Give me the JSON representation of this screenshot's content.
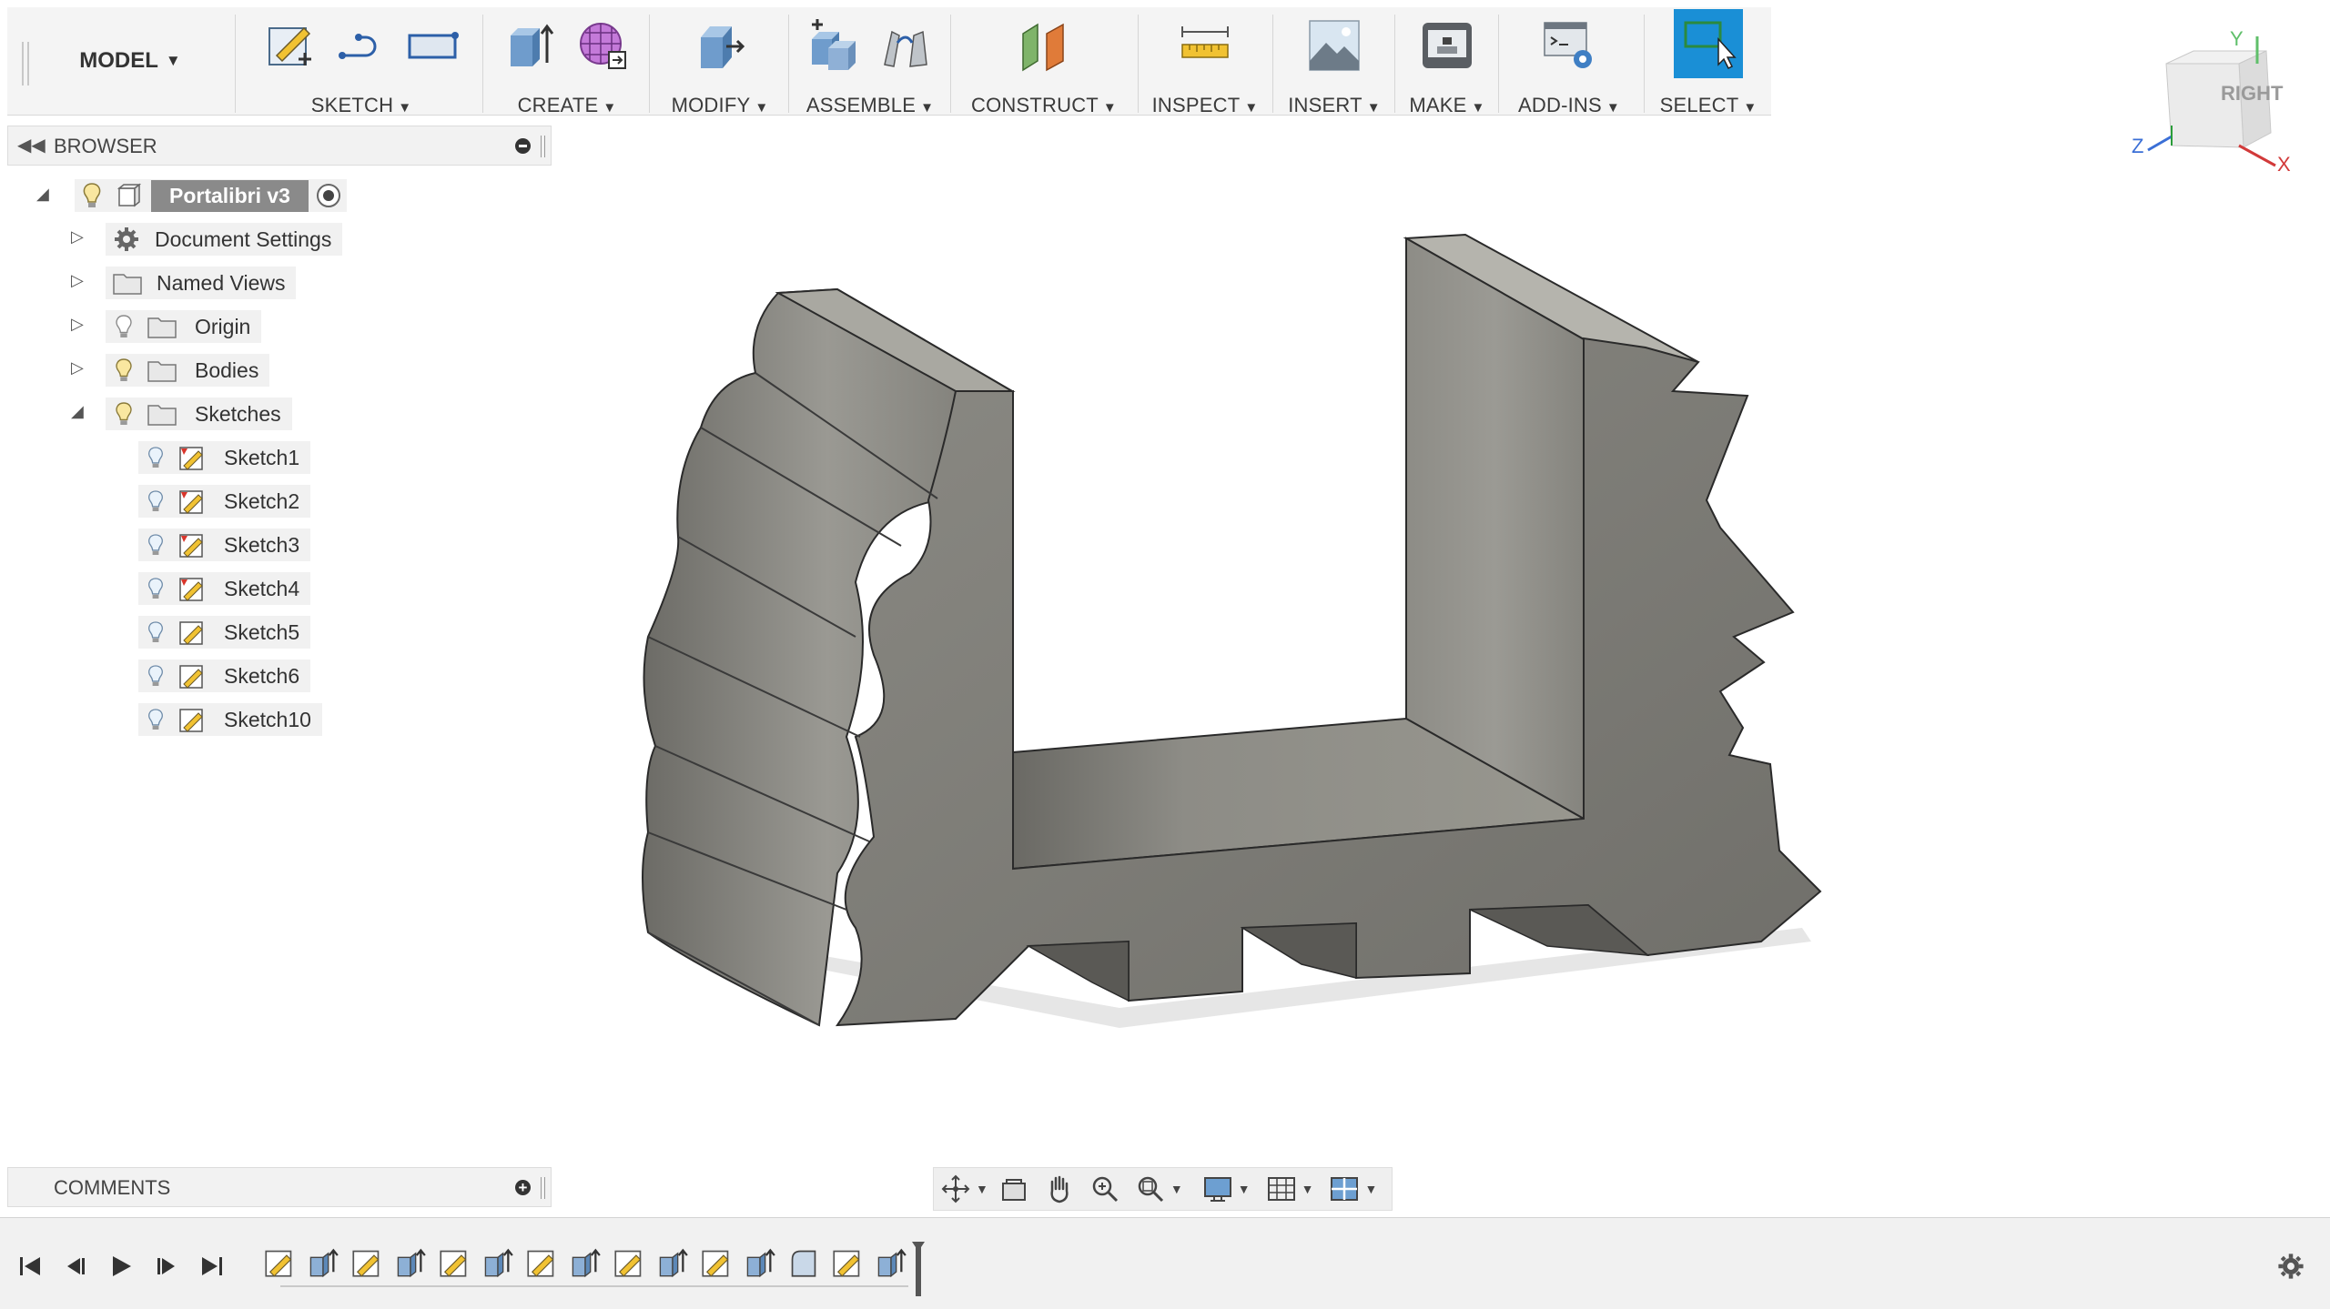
{
  "toolbar": {
    "workspace": "MODEL",
    "groups": [
      {
        "label": "SKETCH"
      },
      {
        "label": "CREATE"
      },
      {
        "label": "MODIFY"
      },
      {
        "label": "ASSEMBLE"
      },
      {
        "label": "CONSTRUCT"
      },
      {
        "label": "INSPECT"
      },
      {
        "label": "INSERT"
      },
      {
        "label": "MAKE"
      },
      {
        "label": "ADD-INS"
      },
      {
        "label": "SELECT"
      }
    ],
    "accent": "#1a8fd6"
  },
  "browser": {
    "title": "BROWSER",
    "root": "Portalibri v3",
    "items": [
      {
        "label": "Document Settings",
        "icon": "gear-icon"
      },
      {
        "label": "Named Views",
        "icon": "folder-icon"
      },
      {
        "label": "Origin",
        "icon": "folder-icon"
      },
      {
        "label": "Bodies",
        "icon": "folder-icon"
      },
      {
        "label": "Sketches",
        "icon": "folder-icon"
      }
    ],
    "sketches": [
      "Sketch1",
      "Sketch2",
      "Sketch3",
      "Sketch4",
      "Sketch5",
      "Sketch6",
      "Sketch10"
    ]
  },
  "comments": {
    "title": "COMMENTS"
  },
  "viewcube": {
    "face": "RIGHT",
    "axis_y": "Y",
    "axis_z": "Z",
    "axis_x": "X"
  },
  "colors": {
    "model_face": "#7d7c76",
    "model_light": "#a4a39c",
    "model_dark": "#5f5e59"
  }
}
